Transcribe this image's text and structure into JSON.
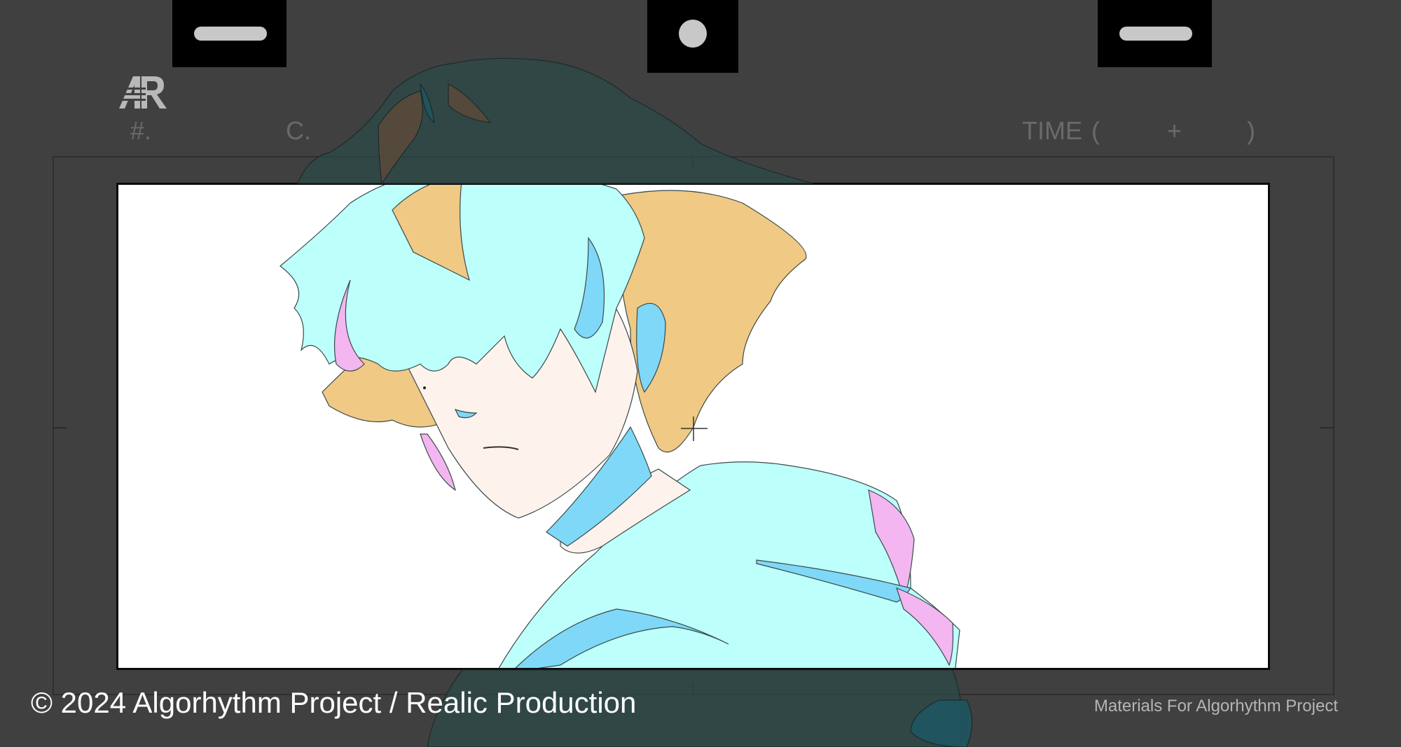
{
  "sheet": {
    "logo_text": "AR",
    "header": {
      "scene_label": "#.",
      "cut_label": "C.",
      "time_label": "TIME",
      "time_open": "(",
      "time_plus": "+",
      "time_close": ")"
    }
  },
  "footer": {
    "copyright": "© 2024 Algorhythm Project / Realic Production",
    "materials_note": "Materials For Algorhythm Project"
  },
  "colors": {
    "background": "#404040",
    "frame_fill": "#ffffff",
    "hair_cyan": "#bdfffb",
    "hair_gold": "#f0c984",
    "skin": "#fdf3ec",
    "shadow_blue": "#7fd8f8",
    "highlight_pink": "#f3b6f0"
  },
  "icons": [
    "peg-slot-icon",
    "peg-hole-icon",
    "ar-logo-icon",
    "registration-cross-icon"
  ]
}
